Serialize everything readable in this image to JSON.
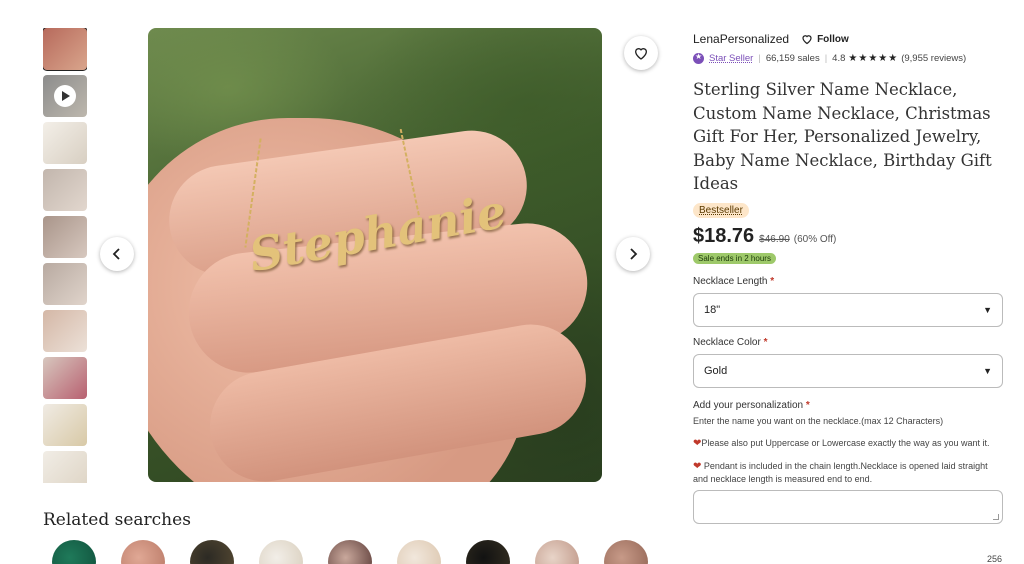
{
  "thumbnails": [
    {
      "kind": "image",
      "colors": [
        "#b76a5c",
        "#d9a58c"
      ],
      "active": true
    },
    {
      "kind": "video",
      "colors": [
        "#8c8c8c",
        "#bdb7ad"
      ],
      "active": false
    },
    {
      "kind": "image",
      "colors": [
        "#f3efe8",
        "#d8cfc2"
      ],
      "active": false
    },
    {
      "kind": "image",
      "colors": [
        "#c2b6ad",
        "#e2d7ce"
      ],
      "active": false
    },
    {
      "kind": "image",
      "colors": [
        "#a9958a",
        "#d7c8bf"
      ],
      "active": false
    },
    {
      "kind": "image",
      "colors": [
        "#b8aaa1",
        "#e0d4cb"
      ],
      "active": false
    },
    {
      "kind": "image",
      "colors": [
        "#d4b7a6",
        "#ece1d8"
      ],
      "active": false
    },
    {
      "kind": "image",
      "colors": [
        "#d7c7be",
        "#b86070"
      ],
      "active": false
    },
    {
      "kind": "image",
      "colors": [
        "#f0ebe4",
        "#d8c9a6"
      ],
      "active": false
    },
    {
      "kind": "image",
      "colors": [
        "#f1ede6",
        "#ddd3c3"
      ],
      "active": false
    }
  ],
  "main_image": {
    "necklace_name": "Stephanie"
  },
  "related": {
    "title": "Related searches",
    "items": [
      {
        "colors": [
          "#1f7a5a",
          "#0f4d39"
        ]
      },
      {
        "colors": [
          "#e0a895",
          "#b57461"
        ]
      },
      {
        "colors": [
          "#2c2a24",
          "#5b4d34"
        ]
      },
      {
        "colors": [
          "#f2eee8",
          "#d6cbb8"
        ]
      },
      {
        "colors": [
          "#c9a89c",
          "#4d2d2a"
        ]
      },
      {
        "colors": [
          "#f1e7dc",
          "#d9c2a8"
        ]
      },
      {
        "colors": [
          "#121212",
          "#3a3323"
        ]
      },
      {
        "colors": [
          "#e8d4c8",
          "#b98e7e"
        ]
      },
      {
        "colors": [
          "#c79a88",
          "#8d5f4f"
        ]
      }
    ]
  },
  "shop": {
    "name": "LenaPersonalized",
    "follow_label": "Follow",
    "star_seller_label": "Star Seller",
    "sales": "66,159 sales",
    "rating": "4.8",
    "stars": "★★★★★",
    "reviews": "(9,955 reviews)"
  },
  "listing": {
    "title": "Sterling Silver Name Necklace, Custom Name Necklace, Christmas Gift For Her, Personalized Jewelry, Baby Name Necklace, Birthday Gift Ideas",
    "badge": "Bestseller",
    "price": "$18.76",
    "original_price": "$46.90",
    "discount": "(60% Off)",
    "sale_note": "Sale ends in 2 hours"
  },
  "options": {
    "length_label": "Necklace Length",
    "length_value": "18\"",
    "color_label": "Necklace Color",
    "color_value": "Gold",
    "required_mark": "*",
    "caret": "▼"
  },
  "personalization": {
    "label": "Add your personalization",
    "instructions_1": "Enter the name you want on the necklace.(max 12 Characters)",
    "instructions_2": "Please also put Uppercase or Lowercase exactly the way as you want it.",
    "instructions_3": "Pendant is included in the chain length.Necklace is opened laid straight and necklace length is measured end to end.",
    "counter": "256"
  },
  "colors": {
    "star_seller": "#7b4fb8",
    "sale_pill": "#9ec96a",
    "bestseller": "#fde6c9",
    "required": "#c0392b"
  }
}
